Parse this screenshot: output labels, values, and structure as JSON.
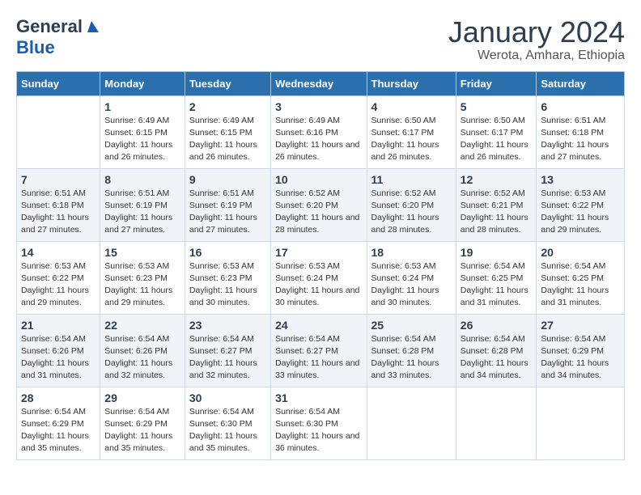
{
  "logo": {
    "line1": "General",
    "line2": "Blue"
  },
  "title": "January 2024",
  "location": "Werota, Amhara, Ethiopia",
  "days_of_week": [
    "Sunday",
    "Monday",
    "Tuesday",
    "Wednesday",
    "Thursday",
    "Friday",
    "Saturday"
  ],
  "weeks": [
    [
      {
        "day": "",
        "sunrise": "",
        "sunset": "",
        "daylight": ""
      },
      {
        "day": "1",
        "sunrise": "Sunrise: 6:49 AM",
        "sunset": "Sunset: 6:15 PM",
        "daylight": "Daylight: 11 hours and 26 minutes."
      },
      {
        "day": "2",
        "sunrise": "Sunrise: 6:49 AM",
        "sunset": "Sunset: 6:15 PM",
        "daylight": "Daylight: 11 hours and 26 minutes."
      },
      {
        "day": "3",
        "sunrise": "Sunrise: 6:49 AM",
        "sunset": "Sunset: 6:16 PM",
        "daylight": "Daylight: 11 hours and 26 minutes."
      },
      {
        "day": "4",
        "sunrise": "Sunrise: 6:50 AM",
        "sunset": "Sunset: 6:17 PM",
        "daylight": "Daylight: 11 hours and 26 minutes."
      },
      {
        "day": "5",
        "sunrise": "Sunrise: 6:50 AM",
        "sunset": "Sunset: 6:17 PM",
        "daylight": "Daylight: 11 hours and 26 minutes."
      },
      {
        "day": "6",
        "sunrise": "Sunrise: 6:51 AM",
        "sunset": "Sunset: 6:18 PM",
        "daylight": "Daylight: 11 hours and 27 minutes."
      }
    ],
    [
      {
        "day": "7",
        "sunrise": "Sunrise: 6:51 AM",
        "sunset": "Sunset: 6:18 PM",
        "daylight": "Daylight: 11 hours and 27 minutes."
      },
      {
        "day": "8",
        "sunrise": "Sunrise: 6:51 AM",
        "sunset": "Sunset: 6:19 PM",
        "daylight": "Daylight: 11 hours and 27 minutes."
      },
      {
        "day": "9",
        "sunrise": "Sunrise: 6:51 AM",
        "sunset": "Sunset: 6:19 PM",
        "daylight": "Daylight: 11 hours and 27 minutes."
      },
      {
        "day": "10",
        "sunrise": "Sunrise: 6:52 AM",
        "sunset": "Sunset: 6:20 PM",
        "daylight": "Daylight: 11 hours and 28 minutes."
      },
      {
        "day": "11",
        "sunrise": "Sunrise: 6:52 AM",
        "sunset": "Sunset: 6:20 PM",
        "daylight": "Daylight: 11 hours and 28 minutes."
      },
      {
        "day": "12",
        "sunrise": "Sunrise: 6:52 AM",
        "sunset": "Sunset: 6:21 PM",
        "daylight": "Daylight: 11 hours and 28 minutes."
      },
      {
        "day": "13",
        "sunrise": "Sunrise: 6:53 AM",
        "sunset": "Sunset: 6:22 PM",
        "daylight": "Daylight: 11 hours and 29 minutes."
      }
    ],
    [
      {
        "day": "14",
        "sunrise": "Sunrise: 6:53 AM",
        "sunset": "Sunset: 6:22 PM",
        "daylight": "Daylight: 11 hours and 29 minutes."
      },
      {
        "day": "15",
        "sunrise": "Sunrise: 6:53 AM",
        "sunset": "Sunset: 6:23 PM",
        "daylight": "Daylight: 11 hours and 29 minutes."
      },
      {
        "day": "16",
        "sunrise": "Sunrise: 6:53 AM",
        "sunset": "Sunset: 6:23 PM",
        "daylight": "Daylight: 11 hours and 30 minutes."
      },
      {
        "day": "17",
        "sunrise": "Sunrise: 6:53 AM",
        "sunset": "Sunset: 6:24 PM",
        "daylight": "Daylight: 11 hours and 30 minutes."
      },
      {
        "day": "18",
        "sunrise": "Sunrise: 6:53 AM",
        "sunset": "Sunset: 6:24 PM",
        "daylight": "Daylight: 11 hours and 30 minutes."
      },
      {
        "day": "19",
        "sunrise": "Sunrise: 6:54 AM",
        "sunset": "Sunset: 6:25 PM",
        "daylight": "Daylight: 11 hours and 31 minutes."
      },
      {
        "day": "20",
        "sunrise": "Sunrise: 6:54 AM",
        "sunset": "Sunset: 6:25 PM",
        "daylight": "Daylight: 11 hours and 31 minutes."
      }
    ],
    [
      {
        "day": "21",
        "sunrise": "Sunrise: 6:54 AM",
        "sunset": "Sunset: 6:26 PM",
        "daylight": "Daylight: 11 hours and 31 minutes."
      },
      {
        "day": "22",
        "sunrise": "Sunrise: 6:54 AM",
        "sunset": "Sunset: 6:26 PM",
        "daylight": "Daylight: 11 hours and 32 minutes."
      },
      {
        "day": "23",
        "sunrise": "Sunrise: 6:54 AM",
        "sunset": "Sunset: 6:27 PM",
        "daylight": "Daylight: 11 hours and 32 minutes."
      },
      {
        "day": "24",
        "sunrise": "Sunrise: 6:54 AM",
        "sunset": "Sunset: 6:27 PM",
        "daylight": "Daylight: 11 hours and 33 minutes."
      },
      {
        "day": "25",
        "sunrise": "Sunrise: 6:54 AM",
        "sunset": "Sunset: 6:28 PM",
        "daylight": "Daylight: 11 hours and 33 minutes."
      },
      {
        "day": "26",
        "sunrise": "Sunrise: 6:54 AM",
        "sunset": "Sunset: 6:28 PM",
        "daylight": "Daylight: 11 hours and 34 minutes."
      },
      {
        "day": "27",
        "sunrise": "Sunrise: 6:54 AM",
        "sunset": "Sunset: 6:29 PM",
        "daylight": "Daylight: 11 hours and 34 minutes."
      }
    ],
    [
      {
        "day": "28",
        "sunrise": "Sunrise: 6:54 AM",
        "sunset": "Sunset: 6:29 PM",
        "daylight": "Daylight: 11 hours and 35 minutes."
      },
      {
        "day": "29",
        "sunrise": "Sunrise: 6:54 AM",
        "sunset": "Sunset: 6:29 PM",
        "daylight": "Daylight: 11 hours and 35 minutes."
      },
      {
        "day": "30",
        "sunrise": "Sunrise: 6:54 AM",
        "sunset": "Sunset: 6:30 PM",
        "daylight": "Daylight: 11 hours and 35 minutes."
      },
      {
        "day": "31",
        "sunrise": "Sunrise: 6:54 AM",
        "sunset": "Sunset: 6:30 PM",
        "daylight": "Daylight: 11 hours and 36 minutes."
      },
      {
        "day": "",
        "sunrise": "",
        "sunset": "",
        "daylight": ""
      },
      {
        "day": "",
        "sunrise": "",
        "sunset": "",
        "daylight": ""
      },
      {
        "day": "",
        "sunrise": "",
        "sunset": "",
        "daylight": ""
      }
    ]
  ]
}
